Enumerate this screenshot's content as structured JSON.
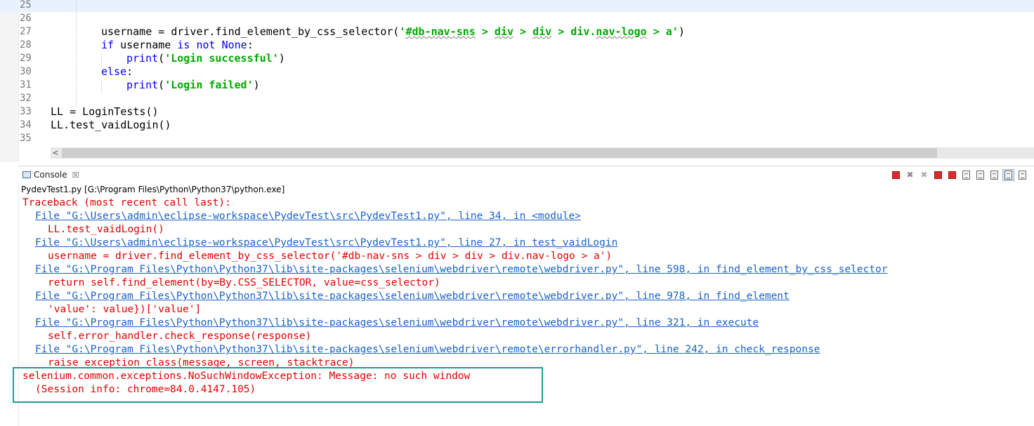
{
  "editor": {
    "lines": [
      {
        "num": "25",
        "current": true
      },
      {
        "num": "26"
      },
      {
        "num": "27",
        "indent": 2,
        "tokens": [
          {
            "t": "username = driver.find_element_by_css_selector("
          },
          {
            "t": "'",
            "c": "str"
          },
          {
            "t": "#db-nav-sns",
            "c": "str squig"
          },
          {
            "t": " > ",
            "c": "str"
          },
          {
            "t": "div",
            "c": "str squig"
          },
          {
            "t": " > ",
            "c": "str"
          },
          {
            "t": "div",
            "c": "str squig"
          },
          {
            "t": " > div.",
            "c": "str"
          },
          {
            "t": "nav-logo",
            "c": "str squig"
          },
          {
            "t": " > a'",
            "c": "str"
          },
          {
            "t": ")"
          }
        ]
      },
      {
        "num": "28",
        "indent": 2,
        "tokens": [
          {
            "t": "if",
            "c": "kw"
          },
          {
            "t": " username "
          },
          {
            "t": "is",
            "c": "kw"
          },
          {
            "t": " "
          },
          {
            "t": "not",
            "c": "kw"
          },
          {
            "t": " "
          },
          {
            "t": "None",
            "c": "kw"
          },
          {
            "t": ":"
          }
        ]
      },
      {
        "num": "29",
        "indent": 3,
        "tokens": [
          {
            "t": "print",
            "c": "kw"
          },
          {
            "t": "("
          },
          {
            "t": "'Login successful'",
            "c": "str"
          },
          {
            "t": ")"
          }
        ]
      },
      {
        "num": "30",
        "indent": 2,
        "tokens": [
          {
            "t": "else",
            "c": "kw"
          },
          {
            "t": ":"
          }
        ]
      },
      {
        "num": "31",
        "indent": 3,
        "tokens": [
          {
            "t": "print",
            "c": "kw"
          },
          {
            "t": "("
          },
          {
            "t": "'Login failed'",
            "c": "str"
          },
          {
            "t": ")"
          }
        ]
      },
      {
        "num": "32"
      },
      {
        "num": "33",
        "indent": 0,
        "tokens": [
          {
            "t": "LL = LoginTests()"
          }
        ]
      },
      {
        "num": "34",
        "indent": 0,
        "tokens": [
          {
            "t": "LL.test_vaidLogin()"
          }
        ]
      },
      {
        "num": "35"
      }
    ],
    "scroll_left_arrow": "<"
  },
  "console": {
    "tab_label": "Console",
    "tab_close": "☒",
    "toolbar": [
      {
        "name": "terminate-icon",
        "kind": "sq"
      },
      {
        "name": "remove-launch-icon",
        "glyph": "✖",
        "color": "#8a8a8a"
      },
      {
        "name": "remove-all-terminated-icon",
        "glyph": "✖",
        "color": "#b0b0b0"
      },
      {
        "name": "stop-icon",
        "kind": "sq"
      },
      {
        "name": "stop-all-icon",
        "kind": "sq"
      },
      {
        "name": "clear-console-icon",
        "kind": "doc"
      },
      {
        "name": "scroll-lock-icon",
        "kind": "doc"
      },
      {
        "name": "word-wrap-icon",
        "kind": "doc"
      },
      {
        "name": "pin-console-icon",
        "kind": "doc",
        "pressed": true
      },
      {
        "name": "display-selected-console-icon",
        "kind": "doc"
      }
    ],
    "path": "PydevTest1.py [G:\\Program Files\\Python\\Python37\\python.exe]",
    "output": [
      {
        "text": "Traceback (most recent call last):",
        "indent": 0
      },
      {
        "text": "File \"G:\\Users\\admin\\eclipse-workspace\\PydevTest\\src\\PydevTest1.py\", line 34, in <module>",
        "indent": 1,
        "link": true
      },
      {
        "text": "LL.test_vaidLogin()",
        "indent": 2
      },
      {
        "text": "File \"G:\\Users\\admin\\eclipse-workspace\\PydevTest\\src\\PydevTest1.py\", line 27, in test_vaidLogin",
        "indent": 1,
        "link": true
      },
      {
        "text": "username = driver.find_element_by_css_selector('#db-nav-sns > div > div > div.nav-logo > a')",
        "indent": 2
      },
      {
        "text": "File \"G:\\Program Files\\Python\\Python37\\lib\\site-packages\\selenium\\webdriver\\remote\\webdriver.py\", line 598, in find_element_by_css_selector",
        "indent": 1,
        "link": true
      },
      {
        "text": "return self.find_element(by=By.CSS_SELECTOR, value=css_selector)",
        "indent": 2
      },
      {
        "text": "File \"G:\\Program Files\\Python\\Python37\\lib\\site-packages\\selenium\\webdriver\\remote\\webdriver.py\", line 978, in find_element",
        "indent": 1,
        "link": true
      },
      {
        "text": "'value': value})['value']",
        "indent": 2
      },
      {
        "text": "File \"G:\\Program Files\\Python\\Python37\\lib\\site-packages\\selenium\\webdriver\\remote\\webdriver.py\", line 321, in execute",
        "indent": 1,
        "link": true
      },
      {
        "text": "self.error_handler.check_response(response)",
        "indent": 2
      },
      {
        "text": "File \"G:\\Program Files\\Python\\Python37\\lib\\site-packages\\selenium\\webdriver\\remote\\errorhandler.py\", line 242, in check_response",
        "indent": 1,
        "link": true
      },
      {
        "text": "raise exception_class(message, screen, stacktrace)",
        "indent": 2
      },
      {
        "text": "selenium.common.exceptions.NoSuchWindowException: Message: no such window",
        "indent": 0
      },
      {
        "text": "(Session info: chrome=84.0.4147.105)",
        "indent": 1
      }
    ]
  },
  "colors": {
    "highlight_border": "#1a9d95",
    "error_text": "#e00000",
    "link_text": "#1a62c8",
    "keyword": "#0000ff",
    "string": "#00aa00"
  }
}
